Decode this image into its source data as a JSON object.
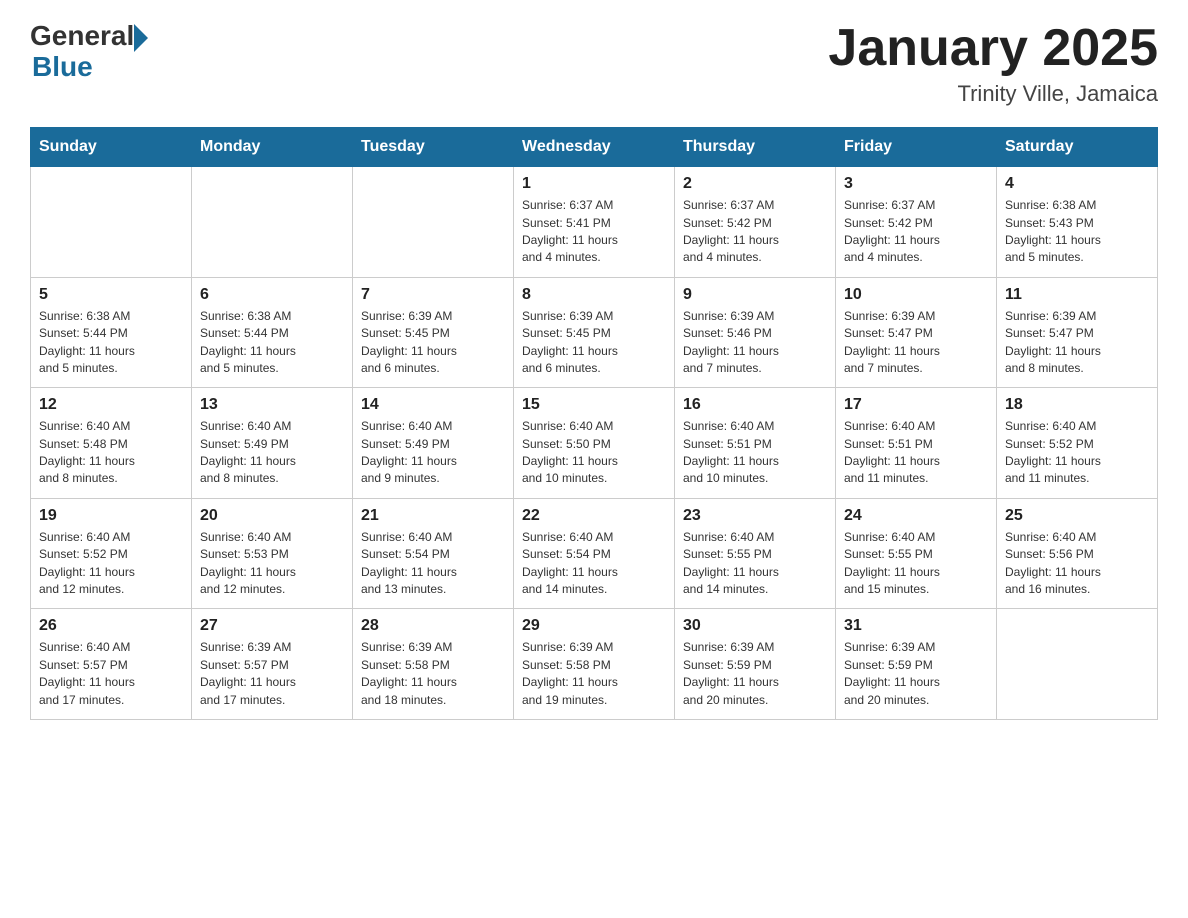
{
  "header": {
    "logo_general": "General",
    "logo_blue": "Blue",
    "title": "January 2025",
    "subtitle": "Trinity Ville, Jamaica"
  },
  "weekdays": [
    "Sunday",
    "Monday",
    "Tuesday",
    "Wednesday",
    "Thursday",
    "Friday",
    "Saturday"
  ],
  "weeks": [
    [
      {
        "day": "",
        "info": ""
      },
      {
        "day": "",
        "info": ""
      },
      {
        "day": "",
        "info": ""
      },
      {
        "day": "1",
        "info": "Sunrise: 6:37 AM\nSunset: 5:41 PM\nDaylight: 11 hours\nand 4 minutes."
      },
      {
        "day": "2",
        "info": "Sunrise: 6:37 AM\nSunset: 5:42 PM\nDaylight: 11 hours\nand 4 minutes."
      },
      {
        "day": "3",
        "info": "Sunrise: 6:37 AM\nSunset: 5:42 PM\nDaylight: 11 hours\nand 4 minutes."
      },
      {
        "day": "4",
        "info": "Sunrise: 6:38 AM\nSunset: 5:43 PM\nDaylight: 11 hours\nand 5 minutes."
      }
    ],
    [
      {
        "day": "5",
        "info": "Sunrise: 6:38 AM\nSunset: 5:44 PM\nDaylight: 11 hours\nand 5 minutes."
      },
      {
        "day": "6",
        "info": "Sunrise: 6:38 AM\nSunset: 5:44 PM\nDaylight: 11 hours\nand 5 minutes."
      },
      {
        "day": "7",
        "info": "Sunrise: 6:39 AM\nSunset: 5:45 PM\nDaylight: 11 hours\nand 6 minutes."
      },
      {
        "day": "8",
        "info": "Sunrise: 6:39 AM\nSunset: 5:45 PM\nDaylight: 11 hours\nand 6 minutes."
      },
      {
        "day": "9",
        "info": "Sunrise: 6:39 AM\nSunset: 5:46 PM\nDaylight: 11 hours\nand 7 minutes."
      },
      {
        "day": "10",
        "info": "Sunrise: 6:39 AM\nSunset: 5:47 PM\nDaylight: 11 hours\nand 7 minutes."
      },
      {
        "day": "11",
        "info": "Sunrise: 6:39 AM\nSunset: 5:47 PM\nDaylight: 11 hours\nand 8 minutes."
      }
    ],
    [
      {
        "day": "12",
        "info": "Sunrise: 6:40 AM\nSunset: 5:48 PM\nDaylight: 11 hours\nand 8 minutes."
      },
      {
        "day": "13",
        "info": "Sunrise: 6:40 AM\nSunset: 5:49 PM\nDaylight: 11 hours\nand 8 minutes."
      },
      {
        "day": "14",
        "info": "Sunrise: 6:40 AM\nSunset: 5:49 PM\nDaylight: 11 hours\nand 9 minutes."
      },
      {
        "day": "15",
        "info": "Sunrise: 6:40 AM\nSunset: 5:50 PM\nDaylight: 11 hours\nand 10 minutes."
      },
      {
        "day": "16",
        "info": "Sunrise: 6:40 AM\nSunset: 5:51 PM\nDaylight: 11 hours\nand 10 minutes."
      },
      {
        "day": "17",
        "info": "Sunrise: 6:40 AM\nSunset: 5:51 PM\nDaylight: 11 hours\nand 11 minutes."
      },
      {
        "day": "18",
        "info": "Sunrise: 6:40 AM\nSunset: 5:52 PM\nDaylight: 11 hours\nand 11 minutes."
      }
    ],
    [
      {
        "day": "19",
        "info": "Sunrise: 6:40 AM\nSunset: 5:52 PM\nDaylight: 11 hours\nand 12 minutes."
      },
      {
        "day": "20",
        "info": "Sunrise: 6:40 AM\nSunset: 5:53 PM\nDaylight: 11 hours\nand 12 minutes."
      },
      {
        "day": "21",
        "info": "Sunrise: 6:40 AM\nSunset: 5:54 PM\nDaylight: 11 hours\nand 13 minutes."
      },
      {
        "day": "22",
        "info": "Sunrise: 6:40 AM\nSunset: 5:54 PM\nDaylight: 11 hours\nand 14 minutes."
      },
      {
        "day": "23",
        "info": "Sunrise: 6:40 AM\nSunset: 5:55 PM\nDaylight: 11 hours\nand 14 minutes."
      },
      {
        "day": "24",
        "info": "Sunrise: 6:40 AM\nSunset: 5:55 PM\nDaylight: 11 hours\nand 15 minutes."
      },
      {
        "day": "25",
        "info": "Sunrise: 6:40 AM\nSunset: 5:56 PM\nDaylight: 11 hours\nand 16 minutes."
      }
    ],
    [
      {
        "day": "26",
        "info": "Sunrise: 6:40 AM\nSunset: 5:57 PM\nDaylight: 11 hours\nand 17 minutes."
      },
      {
        "day": "27",
        "info": "Sunrise: 6:39 AM\nSunset: 5:57 PM\nDaylight: 11 hours\nand 17 minutes."
      },
      {
        "day": "28",
        "info": "Sunrise: 6:39 AM\nSunset: 5:58 PM\nDaylight: 11 hours\nand 18 minutes."
      },
      {
        "day": "29",
        "info": "Sunrise: 6:39 AM\nSunset: 5:58 PM\nDaylight: 11 hours\nand 19 minutes."
      },
      {
        "day": "30",
        "info": "Sunrise: 6:39 AM\nSunset: 5:59 PM\nDaylight: 11 hours\nand 20 minutes."
      },
      {
        "day": "31",
        "info": "Sunrise: 6:39 AM\nSunset: 5:59 PM\nDaylight: 11 hours\nand 20 minutes."
      },
      {
        "day": "",
        "info": ""
      }
    ]
  ]
}
